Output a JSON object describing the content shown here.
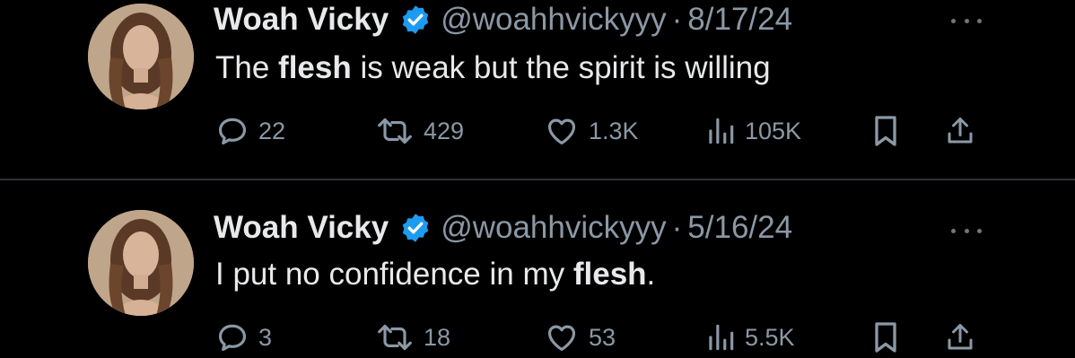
{
  "colors": {
    "background": "#000000",
    "text_primary": "#e7e9ea",
    "text_secondary": "#8b98a5",
    "verified_blue": "#1d9bf0",
    "divider": "#2f3336"
  },
  "tweets": [
    {
      "display_name": "Woah Vicky",
      "handle": "@woahhvickyyy",
      "separator": "·",
      "date": "8/17/24",
      "text_parts": [
        "The ",
        "flesh",
        " is weak but the spirit is willing"
      ],
      "replies": "22",
      "retweets": "429",
      "likes": "1.3K",
      "views": "105K",
      "icons": [
        "verified-badge-icon",
        "more-icon",
        "reply-icon",
        "retweet-icon",
        "like-icon",
        "views-icon",
        "bookmark-icon",
        "share-icon"
      ]
    },
    {
      "display_name": "Woah Vicky",
      "handle": "@woahhvickyyy",
      "separator": "·",
      "date": "5/16/24",
      "text_parts": [
        "I put no confidence in my ",
        "flesh",
        "."
      ],
      "replies": "3",
      "retweets": "18",
      "likes": "53",
      "views": "5.5K",
      "icons": [
        "verified-badge-icon",
        "more-icon",
        "reply-icon",
        "retweet-icon",
        "like-icon",
        "views-icon",
        "bookmark-icon",
        "share-icon"
      ]
    }
  ]
}
